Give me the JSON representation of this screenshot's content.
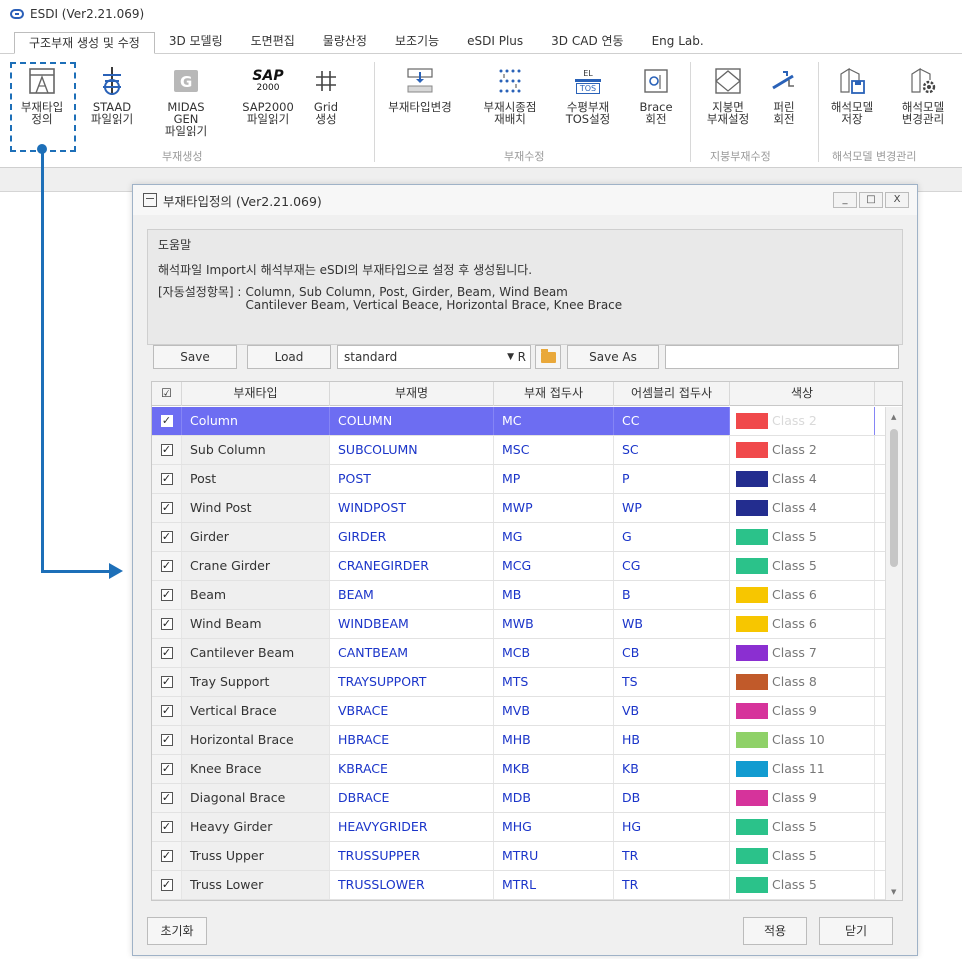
{
  "app": {
    "title": "ESDI (Ver2.21.069)"
  },
  "menu": [
    {
      "label": "구조부재 생성 및 수정",
      "active": true
    },
    {
      "label": "3D 모델링"
    },
    {
      "label": "도면편집"
    },
    {
      "label": "물량산정"
    },
    {
      "label": "보조기능"
    },
    {
      "label": "eSDI Plus"
    },
    {
      "label": "3D CAD 연동"
    },
    {
      "label": "Eng Lab."
    }
  ],
  "ribbon": {
    "buttons": [
      {
        "label": "부재타입\n정의",
        "icon": "member-type-icon"
      },
      {
        "label": "STAAD\n파일읽기",
        "icon": "staad-icon"
      },
      {
        "label": "MIDAS GEN\n파일읽기",
        "icon": "midas-icon"
      },
      {
        "label": "SAP2000\n파일읽기",
        "icon": "sap2000-icon"
      },
      {
        "label": "Grid\n생성",
        "icon": "grid-icon"
      },
      {
        "label": "부재타입변경",
        "icon": "change-type-icon"
      },
      {
        "label": "부재시종점\n재배치",
        "icon": "relocate-icon"
      },
      {
        "label": "수평부재\nTOS설정",
        "icon": "tos-icon"
      },
      {
        "label": "Brace\n회전",
        "icon": "brace-rotate-icon"
      },
      {
        "label": "지붕면\n부재설정",
        "icon": "roof-icon"
      },
      {
        "label": "퍼린\n회전",
        "icon": "purlin-rotate-icon"
      },
      {
        "label": "해석모델\n저장",
        "icon": "model-save-icon"
      },
      {
        "label": "해석모델\n변경관리",
        "icon": "model-manage-icon"
      }
    ],
    "groups": [
      "부재생성",
      "부재수정",
      "지붕부재수정",
      "해석모델 변경관리"
    ],
    "sap_logo": "SAP",
    "sap_sub": "2000",
    "tos_text": "TOS",
    "el_text": "EL"
  },
  "dialog": {
    "title": "부재타입정의 (Ver2.21.069)",
    "controls": [
      "_",
      "□",
      "X"
    ],
    "help": {
      "title": "도움말",
      "line1": "해석파일 Import시 해석부재는 eSDI의 부재타입으로 설정 후 생성됩니다.",
      "auto_label": "[자동설정항목] :",
      "auto_line1": "Column, Sub Column, Post, Girder, Beam, Wind Beam",
      "auto_line2": "Cantilever Beam, Vertical Beace, Horizontal Brace, Knee Brace"
    },
    "toolbar": {
      "save": "Save",
      "load": "Load",
      "preset": "standard",
      "preset_suffix": "R",
      "save_as": "Save As",
      "name_input": ""
    },
    "columns": [
      "부재타입",
      "부재명",
      "부재 접두사",
      "어셈블리 접두사",
      "색상"
    ],
    "header_check": "☑",
    "rows": [
      {
        "type": "Column",
        "name": "COLUMN",
        "prefix": "MC",
        "asm": "CC",
        "color": "#f0494b",
        "cls": "Class 2",
        "selected": true
      },
      {
        "type": "Sub Column",
        "name": "SUBCOLUMN",
        "prefix": "MSC",
        "asm": "SC",
        "color": "#f0494b",
        "cls": "Class 2"
      },
      {
        "type": "Post",
        "name": "POST",
        "prefix": "MP",
        "asm": "P",
        "color": "#232d8f",
        "cls": "Class 4"
      },
      {
        "type": "Wind Post",
        "name": "WINDPOST",
        "prefix": "MWP",
        "asm": "WP",
        "color": "#232d8f",
        "cls": "Class 4"
      },
      {
        "type": "Girder",
        "name": "GIRDER",
        "prefix": "MG",
        "asm": "G",
        "color": "#2bc28a",
        "cls": "Class 5"
      },
      {
        "type": "Crane Girder",
        "name": "CRANEGIRDER",
        "prefix": "MCG",
        "asm": "CG",
        "color": "#2bc28a",
        "cls": "Class 5"
      },
      {
        "type": "Beam",
        "name": "BEAM",
        "prefix": "MB",
        "asm": "B",
        "color": "#f7c600",
        "cls": "Class 6"
      },
      {
        "type": "Wind Beam",
        "name": "WINDBEAM",
        "prefix": "MWB",
        "asm": "WB",
        "color": "#f7c600",
        "cls": "Class 6"
      },
      {
        "type": "Cantilever Beam",
        "name": "CANTBEAM",
        "prefix": "MCB",
        "asm": "CB",
        "color": "#8b2fd1",
        "cls": "Class 7"
      },
      {
        "type": "Tray Support",
        "name": "TRAYSUPPORT",
        "prefix": "MTS",
        "asm": "TS",
        "color": "#c15a2a",
        "cls": "Class 8"
      },
      {
        "type": "Vertical Brace",
        "name": "VBRACE",
        "prefix": "MVB",
        "asm": "VB",
        "color": "#d6339b",
        "cls": "Class 9"
      },
      {
        "type": "Horizontal Brace",
        "name": "HBRACE",
        "prefix": "MHB",
        "asm": "HB",
        "color": "#8fd168",
        "cls": "Class 10"
      },
      {
        "type": "Knee Brace",
        "name": "KBRACE",
        "prefix": "MKB",
        "asm": "KB",
        "color": "#129bd0",
        "cls": "Class 11"
      },
      {
        "type": "Diagonal Brace",
        "name": "DBRACE",
        "prefix": "MDB",
        "asm": "DB",
        "color": "#d6339b",
        "cls": "Class 9"
      },
      {
        "type": "Heavy Girder",
        "name": "HEAVYGRIDER",
        "prefix": "MHG",
        "asm": "HG",
        "color": "#2bc28a",
        "cls": "Class 5"
      },
      {
        "type": "Truss Upper",
        "name": "TRUSSUPPER",
        "prefix": "MTRU",
        "asm": "TR",
        "color": "#2bc28a",
        "cls": "Class 5"
      },
      {
        "type": "Truss Lower",
        "name": "TRUSSLOWER",
        "prefix": "MTRL",
        "asm": "TR",
        "color": "#2bc28a",
        "cls": "Class 5"
      }
    ],
    "footer": {
      "reset": "초기화",
      "apply": "적용",
      "close": "닫기"
    }
  },
  "accent_color": "#1d6fb8",
  "selection_color": "#6d6df2"
}
